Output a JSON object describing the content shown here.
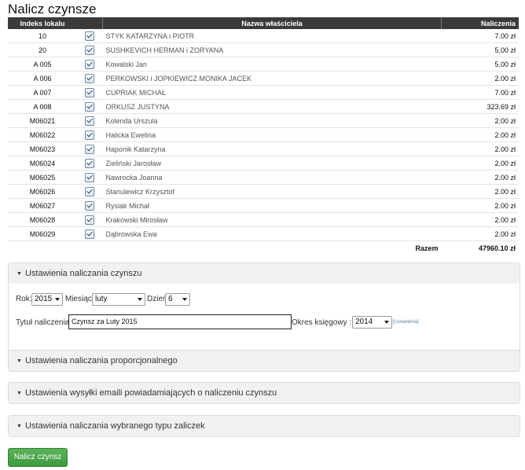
{
  "page": {
    "title": "Nalicz czynsze"
  },
  "table": {
    "headers": {
      "index": "Indeks lokalu",
      "owner": "Nazwa właściciela",
      "charges": "Naliczenia"
    },
    "rows": [
      {
        "index": "10",
        "owner": "STYK KATARZYNA i PIOTR",
        "amount": "7.00 zł"
      },
      {
        "index": "20",
        "owner": "SUSHKEVICH HERMAN i ZORYANA",
        "amount": "5.00 zł"
      },
      {
        "index": "A 005",
        "owner": "Kowalski Jan",
        "amount": "5.00 zł"
      },
      {
        "index": "A 006",
        "owner": "PERKOWSKI i JOPKIEWICZ MONIKA JACEK",
        "amount": "2.00 zł"
      },
      {
        "index": "A 007",
        "owner": "CUPRIAK MICHAŁ",
        "amount": "7.00 zł"
      },
      {
        "index": "A 008",
        "owner": "ORKUSZ JUSTYNA",
        "amount": "323.69 zł"
      },
      {
        "index": "M06021",
        "owner": "Kolenda Urszula",
        "amount": "2.00 zł"
      },
      {
        "index": "M06022",
        "owner": "Halicka Ewelina",
        "amount": "2.00 zł"
      },
      {
        "index": "M06023",
        "owner": "Haponik Katarzyna",
        "amount": "2.00 zł"
      },
      {
        "index": "M06024",
        "owner": "Zieliński Jarosław",
        "amount": "2.00 zł"
      },
      {
        "index": "M06025",
        "owner": "Nawrocka Joanna",
        "amount": "2.00 zł"
      },
      {
        "index": "M06026",
        "owner": "Stanulewicz Krzysztof",
        "amount": "2.00 zł"
      },
      {
        "index": "M06027",
        "owner": "Rysiak Michał",
        "amount": "2.00 zł"
      },
      {
        "index": "M06028",
        "owner": "Krakowski Mirosław",
        "amount": "2.00 zł"
      },
      {
        "index": "M06029",
        "owner": "Dąbrowska Ewa",
        "amount": "2.00 zł"
      }
    ],
    "total_label": "Razem",
    "total_value": "47960.10 zł"
  },
  "settings": {
    "title": "Ustawienia naliczania czynszu",
    "year_label": "Rok:",
    "year_value": "2015",
    "month_label": "Miesiąc:",
    "month_value": "luty",
    "day_label": "Dzień",
    "day_value": "6",
    "charge_title_label": "Tytuł naliczenia:",
    "charge_title_value": "Czynsz za Luty 2015",
    "period_label": "Okres księgowy :",
    "period_value": "2014",
    "settings_link": "[Ustawienia]"
  },
  "panels": {
    "proportional": "Ustawienia naliczania proporcjonalnego",
    "emails": "Ustawienia wysyłki emaili powiadamiających o naliczeniu czynszu",
    "advances": "Ustawienia naliczania wybranego typu zaliczek"
  },
  "submit_button": "Nalicz czynsz",
  "icons": {
    "caret": "caret-down-icon",
    "checkbox": "checkbox-checked-icon"
  }
}
